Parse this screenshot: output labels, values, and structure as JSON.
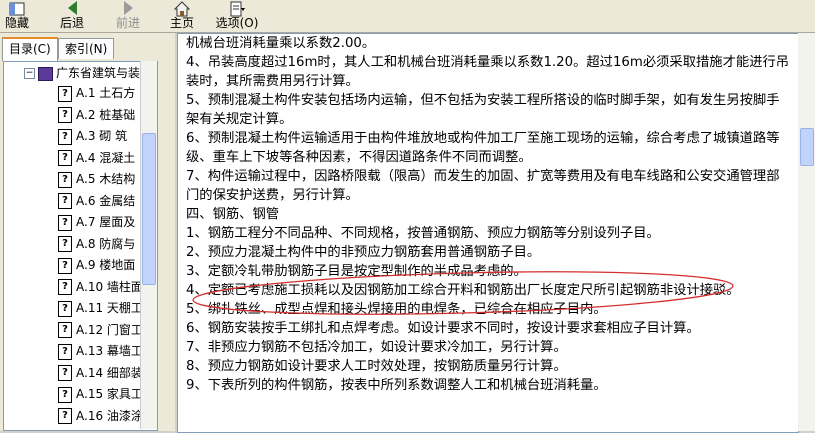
{
  "toolbar": {
    "hide": "隐藏",
    "back": "后退",
    "forward": "前进",
    "home": "主页",
    "options": "选项(O)"
  },
  "tabs": {
    "contents": "目录(C)",
    "index": "索引(N)"
  },
  "tree": {
    "root": "广东省建筑与装",
    "items": [
      "A.1 土石方",
      "A.2 桩基础",
      "A.3 砌 筑",
      "A.4 混凝土",
      "A.5 木结构",
      "A.6 金属结",
      "A.7 屋面及",
      "A.8 防腐与",
      "A.9 楼地面",
      "A.10 墙柱面",
      "A.11 天棚工",
      "A.12 门窗工",
      "A.13 幕墙工",
      "A.14 细部装",
      "A.15 家具工",
      "A.16 油漆涂"
    ]
  },
  "content": {
    "lines": [
      "机械台班消耗量乘以系数2.00。",
      "    4、吊装高度超过16m时，其人工和机械台班消耗量乘以系数1.20。超过16m必须采取措施才能进行吊装时，其所需费用另行计算。",
      "    5、预制混凝土构件安装包括场内运输，但不包括为安装工程所搭设的临时脚手架，如有发生另按脚手架有关规定计算。",
      "    6、预制混凝土构件运输适用于由构件堆放地或构件加工厂至施工现场的运输，综合考虑了城镇道路等级、重车上下坡等各种因素，不得因道路条件不同而调整。",
      "    7、构件运输过程中，因路桥限载（限高）而发生的加固、扩宽等费用及有电车线路和公安交通管理部门的保安护送费，另行计算。",
      "    四、钢筋、钢管",
      "    1、钢筋工程分不同品种、不同规格，按普通钢筋、预应力钢筋等分别设列子目。",
      "    2、预应力混凝土构件中的非预应力钢筋套用普通钢筋子目。",
      "    3、定额冷轧带肋钢筋子目是按定型制作的半成品考虑的。",
      "    4、定额已考虑施工损耗以及因钢筋加工综合开料和钢筋出厂长度定尺所引起钢筋非设计接驳。",
      "    5、绑扎铁丝、成型点焊和接头焊接用的电焊条，已综合在相应子目内。",
      "    6、钢筋安装按手工绑扎和点焊考虑。如设计要求不同时，按设计要求套相应子目计算。",
      "    7、非预应力钢筋不包括冷加工，如设计要求冷加工，另行计算。",
      "    8、预应力钢筋如设计要求人工时效处理，按钢筋质量另行计算。",
      "    9、下表所列的构件钢筋，按表中所列系数调整人工和机械台班消耗量。"
    ]
  },
  "colors": {
    "annotation": "#d32f2f",
    "toolbar_bg": "#ece9d8"
  }
}
